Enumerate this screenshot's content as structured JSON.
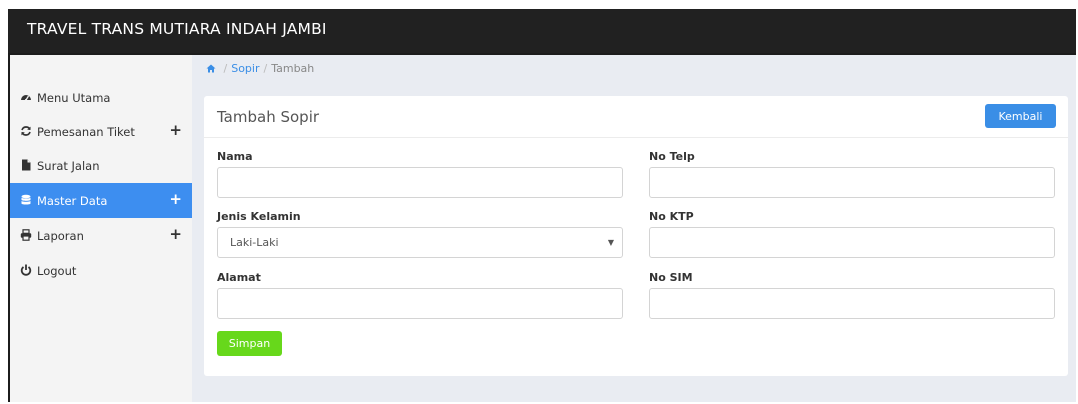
{
  "app": {
    "title": "TRAVEL TRANS MUTIARA INDAH JAMBI"
  },
  "sidebar": {
    "items": [
      {
        "label": "Menu Utama",
        "icon": "dashboard-icon",
        "has_plus": false,
        "active": false
      },
      {
        "label": "Pemesanan Tiket",
        "icon": "refresh-icon",
        "has_plus": true,
        "active": false
      },
      {
        "label": "Surat Jalan",
        "icon": "file-icon",
        "has_plus": false,
        "active": false
      },
      {
        "label": "Master Data",
        "icon": "database-icon",
        "has_plus": true,
        "active": true
      },
      {
        "label": "Laporan",
        "icon": "print-icon",
        "has_plus": true,
        "active": false
      },
      {
        "label": "Logout",
        "icon": "power-icon",
        "has_plus": false,
        "active": false
      }
    ]
  },
  "breadcrumb": {
    "home_icon": "home-icon",
    "link": "Sopir",
    "current": "Tambah"
  },
  "form": {
    "title": "Tambah Sopir",
    "back_label": "Kembali",
    "save_label": "Simpan",
    "fields": {
      "nama": {
        "label": "Nama",
        "value": ""
      },
      "no_telp": {
        "label": "No Telp",
        "value": ""
      },
      "jenis_kelamin": {
        "label": "Jenis Kelamin",
        "value": "Laki-Laki"
      },
      "no_ktp": {
        "label": "No KTP",
        "value": ""
      },
      "alamat": {
        "label": "Alamat",
        "value": ""
      },
      "no_sim": {
        "label": "No SIM",
        "value": ""
      }
    }
  },
  "colors": {
    "topbar": "#212121",
    "sidebar_bg": "#f4f4f4",
    "active_item": "#3d8ef0",
    "primary_button": "#3a8ee6",
    "save_button": "#67d81b",
    "content_bg": "#e9ecf2"
  }
}
